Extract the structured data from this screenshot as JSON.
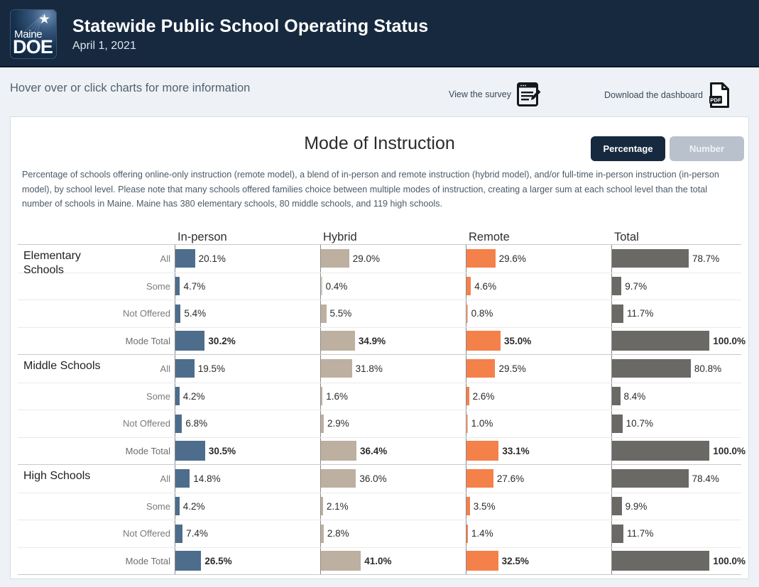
{
  "header": {
    "logo": {
      "line1": "Maine",
      "line2": "DOE",
      "star": "★",
      "name": "maine-doe-logo"
    },
    "title": "Statewide Public School Operating Status",
    "subtitle": "April 1, 2021"
  },
  "toolbar": {
    "hint": "Hover over or click charts for more information",
    "survey_label": "View the survey",
    "download_label": "Download the dashboard",
    "pdf_badge": "PDF"
  },
  "card": {
    "chart_title": "Mode of Instruction",
    "toggle": {
      "percentage": "Percentage",
      "number": "Number",
      "selected": "Percentage"
    },
    "description": "Percentage of schools offering online-only instruction (remote model), a blend of in-person and remote instruction (hybrid model), and/or full-time in-person instruction (in-person model), by school level. Please note that many schools offered families choice between multiple modes of instruction, creating a larger sum at each school level than the total number of schools in Maine. Maine has 380 elementary schools, 80 middle schools, and 119 high schools."
  },
  "colors": {
    "in_person": "#4e6d8d",
    "hybrid": "#bdb0a0",
    "remote": "#f4804a",
    "total": "#6b6966",
    "header_bg": "#16293f",
    "page_bg": "#eef2f6",
    "toggle_active": "#16293f",
    "toggle_inactive": "#b9c2cc"
  },
  "chart_data": {
    "type": "bar",
    "title": "Mode of Instruction",
    "unit": "%",
    "xlim": [
      0,
      100
    ],
    "grid": false,
    "legend": "none",
    "columns": [
      "In-person",
      "Hybrid",
      "Remote",
      "Total"
    ],
    "rows": [
      "All",
      "Some",
      "Not Offered",
      "Mode Total"
    ],
    "groups": [
      {
        "name": "Elementary Schools",
        "rows": [
          {
            "label": "All",
            "values": [
              20.1,
              29.0,
              29.6,
              78.7
            ],
            "text": [
              "20.1%",
              "29.0%",
              "29.6%",
              "78.7%"
            ]
          },
          {
            "label": "Some",
            "values": [
              4.7,
              0.4,
              4.6,
              9.7
            ],
            "text": [
              "4.7%",
              "0.4%",
              "4.6%",
              "9.7%"
            ]
          },
          {
            "label": "Not Offered",
            "values": [
              5.4,
              5.5,
              0.8,
              11.7
            ],
            "text": [
              "5.4%",
              "5.5%",
              "0.8%",
              "11.7%"
            ]
          },
          {
            "label": "Mode Total",
            "values": [
              30.2,
              34.9,
              35.0,
              100.0
            ],
            "text": [
              "30.2%",
              "34.9%",
              "35.0%",
              "100.0%"
            ]
          }
        ]
      },
      {
        "name": "Middle Schools",
        "rows": [
          {
            "label": "All",
            "values": [
              19.5,
              31.8,
              29.5,
              80.8
            ],
            "text": [
              "19.5%",
              "31.8%",
              "29.5%",
              "80.8%"
            ]
          },
          {
            "label": "Some",
            "values": [
              4.2,
              1.6,
              2.6,
              8.4
            ],
            "text": [
              "4.2%",
              "1.6%",
              "2.6%",
              "8.4%"
            ]
          },
          {
            "label": "Not Offered",
            "values": [
              6.8,
              2.9,
              1.0,
              10.7
            ],
            "text": [
              "6.8%",
              "2.9%",
              "1.0%",
              "10.7%"
            ]
          },
          {
            "label": "Mode Total",
            "values": [
              30.5,
              36.4,
              33.1,
              100.0
            ],
            "text": [
              "30.5%",
              "36.4%",
              "33.1%",
              "100.0%"
            ]
          }
        ]
      },
      {
        "name": "High Schools",
        "rows": [
          {
            "label": "All",
            "values": [
              14.8,
              36.0,
              27.6,
              78.4
            ],
            "text": [
              "14.8%",
              "36.0%",
              "27.6%",
              "78.4%"
            ]
          },
          {
            "label": "Some",
            "values": [
              4.2,
              2.1,
              3.5,
              9.9
            ],
            "text": [
              "4.2%",
              "2.1%",
              "3.5%",
              "9.9%"
            ]
          },
          {
            "label": "Not Offered",
            "values": [
              7.4,
              2.8,
              1.4,
              11.7
            ],
            "text": [
              "7.4%",
              "2.8%",
              "1.4%",
              "11.7%"
            ]
          },
          {
            "label": "Mode Total",
            "values": [
              26.5,
              41.0,
              32.5,
              100.0
            ],
            "text": [
              "26.5%",
              "41.0%",
              "32.5%",
              "100.0%"
            ]
          }
        ]
      }
    ]
  }
}
